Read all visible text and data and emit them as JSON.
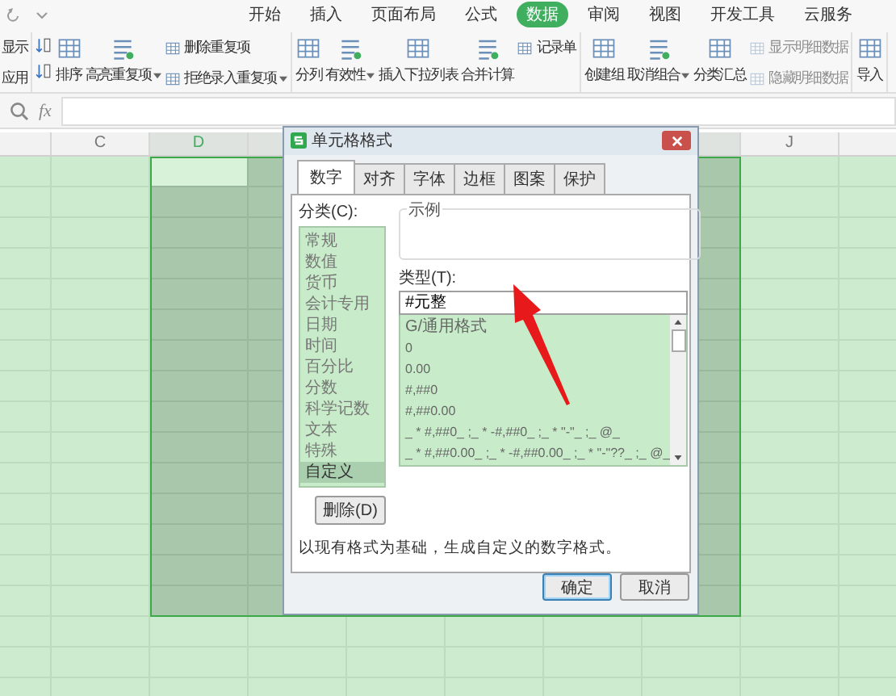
{
  "menu_tabs": [
    {
      "label": "开始",
      "selected": false
    },
    {
      "label": "插入",
      "selected": false
    },
    {
      "label": "页面布局",
      "selected": false
    },
    {
      "label": "公式",
      "selected": false
    },
    {
      "label": "数据",
      "selected": true
    },
    {
      "label": "审阅",
      "selected": false
    },
    {
      "label": "视图",
      "selected": false
    },
    {
      "label": "开发工具",
      "selected": false
    },
    {
      "label": "云服务",
      "selected": false
    }
  ],
  "ribbon": {
    "groups": [
      {
        "items": [
          {
            "kind": "text",
            "label": "显示",
            "disabled": false,
            "dropdown": false
          },
          {
            "kind": "text",
            "label": "应用",
            "disabled": false,
            "dropdown": false
          }
        ]
      },
      {
        "items": [
          {
            "kind": "icon",
            "disabled": false,
            "dropdown": false
          },
          {
            "kind": "icon",
            "disabled": false,
            "dropdown": false
          },
          {
            "kind": "large",
            "label": "排序",
            "disabled": false,
            "dropdown": false
          },
          {
            "kind": "large",
            "label": "高亮重复项",
            "disabled": false,
            "dropdown": true
          },
          {
            "kind": "small",
            "label": "删除重复项",
            "disabled": false,
            "dropdown": false
          },
          {
            "kind": "small",
            "label": "拒绝录入重复项",
            "disabled": false,
            "dropdown": true
          }
        ]
      },
      {
        "items": [
          {
            "kind": "large",
            "label": "分列",
            "disabled": false,
            "dropdown": false
          },
          {
            "kind": "large",
            "label": "有效性",
            "disabled": false,
            "dropdown": true
          },
          {
            "kind": "large",
            "label": "插入下拉列表",
            "disabled": false,
            "dropdown": false
          },
          {
            "kind": "large",
            "label": "合并计算",
            "disabled": false,
            "dropdown": false
          },
          {
            "kind": "small",
            "label": "记录单",
            "disabled": false,
            "dropdown": false
          }
        ]
      },
      {
        "items": [
          {
            "kind": "large",
            "label": "创建组",
            "disabled": false,
            "dropdown": false
          },
          {
            "kind": "large",
            "label": "取消组合",
            "disabled": false,
            "dropdown": true
          },
          {
            "kind": "large",
            "label": "分类汇总",
            "disabled": false,
            "dropdown": false
          },
          {
            "kind": "small",
            "label": "显示明细数据",
            "disabled": true,
            "dropdown": false
          },
          {
            "kind": "small",
            "label": "隐藏明细数据",
            "disabled": true,
            "dropdown": false
          }
        ]
      },
      {
        "items": [
          {
            "kind": "large",
            "label": "导入",
            "disabled": false,
            "dropdown": false
          }
        ]
      }
    ]
  },
  "formula_bar": {
    "fx_label": "fx"
  },
  "sheet": {
    "columns": [
      {
        "selected": false,
        "active": false
      },
      {
        "label": "C",
        "selected": false,
        "active": false
      },
      {
        "label": "D",
        "selected": true,
        "active": true
      },
      {
        "selected": true,
        "active": false
      },
      {},
      {},
      {},
      {
        "selected": true,
        "active": false
      },
      {
        "label": "J",
        "selected": false,
        "active": false
      },
      {
        "selected": false,
        "active": false
      }
    ],
    "rows": [
      {
        "selected": true,
        "active": true
      },
      {
        "selected": true,
        "active": false
      },
      {
        "selected": true,
        "active": false
      },
      {
        "selected": true,
        "active": false
      },
      {
        "selected": true,
        "active": false
      },
      {
        "selected": true,
        "active": false
      },
      {
        "selected": true,
        "active": false
      },
      {
        "selected": true,
        "active": false
      },
      {
        "selected": true,
        "active": false
      },
      {
        "selected": true,
        "active": false
      },
      {
        "selected": true,
        "active": false
      },
      {
        "selected": true,
        "active": false
      },
      {
        "selected": true,
        "active": false
      },
      {
        "selected": true,
        "active": false
      },
      {
        "selected": true,
        "active": false
      },
      {
        "selected": false,
        "active": false
      },
      {
        "selected": false,
        "active": false
      },
      {
        "selected": false,
        "active": false
      }
    ]
  },
  "dialog": {
    "title": "单元格格式",
    "tabs": [
      {
        "label": "数字",
        "selected": true
      },
      {
        "label": "对齐",
        "selected": false
      },
      {
        "label": "字体",
        "selected": false
      },
      {
        "label": "边框",
        "selected": false
      },
      {
        "label": "图案",
        "selected": false
      },
      {
        "label": "保护",
        "selected": false
      }
    ],
    "category_label": "分类(C):",
    "categories": [
      {
        "label": "常规",
        "selected": false
      },
      {
        "label": "数值",
        "selected": false
      },
      {
        "label": "货币",
        "selected": false
      },
      {
        "label": "会计专用",
        "selected": false
      },
      {
        "label": "日期",
        "selected": false
      },
      {
        "label": "时间",
        "selected": false
      },
      {
        "label": "百分比",
        "selected": false
      },
      {
        "label": "分数",
        "selected": false
      },
      {
        "label": "科学记数",
        "selected": false
      },
      {
        "label": "文本",
        "selected": false
      },
      {
        "label": "特殊",
        "selected": false
      },
      {
        "label": "自定义",
        "selected": true
      }
    ],
    "sample_label": "示例",
    "type_label": "类型(T):",
    "type_value": "#元整",
    "type_options": [
      "G/通用格式",
      "0",
      "0.00",
      "#,##0",
      "#,##0.00",
      "_ * #,##0_ ;_ * -#,##0_ ;_ * \"-\"_ ;_ @_",
      "_ * #,##0.00_ ;_ * -#,##0.00_ ;_ * \"-\"??_ ;_ @_"
    ],
    "delete_button": "删除(D)",
    "description": "以现有格式为基础，生成自定义的数字格式。",
    "buttons": [
      {
        "label": "确定",
        "default": true
      },
      {
        "label": "取消",
        "default": false
      }
    ]
  },
  "annotation": {
    "kind": "arrow"
  }
}
